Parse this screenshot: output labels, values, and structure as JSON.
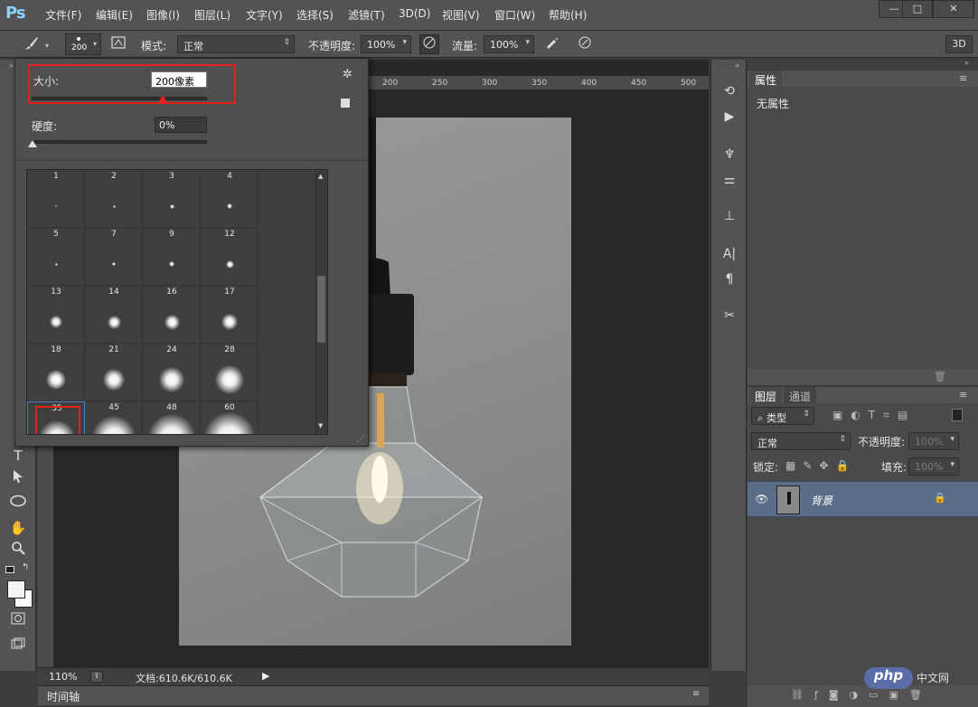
{
  "app": {
    "logo": "Ps"
  },
  "menu": [
    "文件(F)",
    "编辑(E)",
    "图像(I)",
    "图层(L)",
    "文字(Y)",
    "选择(S)",
    "滤镜(T)",
    "3D(D)",
    "视图(V)",
    "窗口(W)",
    "帮助(H)"
  ],
  "window_buttons": [
    "—",
    "□",
    "✕"
  ],
  "options": {
    "brush_size": "200",
    "mode_label": "模式:",
    "mode_value": "正常",
    "opacity_label": "不透明度:",
    "opacity_value": "100%",
    "flow_label": "流量:",
    "flow_value": "100%",
    "threed_label": "3D"
  },
  "brush_popup": {
    "size_label": "大小:",
    "size_value": "200像素",
    "hardness_label": "硬度:",
    "hardness_value": "0%",
    "presets": [
      {
        "label": "1",
        "d": 2
      },
      {
        "label": "2",
        "d": 3
      },
      {
        "label": "3",
        "d": 5
      },
      {
        "label": "4",
        "d": 6
      },
      {
        "label": "5",
        "d": 3
      },
      {
        "label": "7",
        "d": 4
      },
      {
        "label": "9",
        "d": 6
      },
      {
        "label": "12",
        "d": 9
      },
      {
        "label": "13",
        "d": 14
      },
      {
        "label": "14",
        "d": 15
      },
      {
        "label": "16",
        "d": 17
      },
      {
        "label": "17",
        "d": 18
      },
      {
        "label": "18",
        "d": 22
      },
      {
        "label": "21",
        "d": 24
      },
      {
        "label": "24",
        "d": 28
      },
      {
        "label": "28",
        "d": 32
      },
      {
        "label": "35",
        "d": 40
      },
      {
        "label": "45",
        "d": 48
      },
      {
        "label": "48",
        "d": 52
      },
      {
        "label": "60",
        "d": 56
      },
      {
        "label": "",
        "d": 52
      },
      {
        "label": "",
        "d": 52
      },
      {
        "label": "",
        "d": 52
      },
      {
        "label": "",
        "d": 52
      }
    ]
  },
  "rulers": {
    "top": [
      "200",
      "250",
      "300",
      "350",
      "400",
      "450",
      "500"
    ]
  },
  "status": {
    "zoom": "110%",
    "doc": "文档:610.6K/610.6K"
  },
  "timeline_label": "时间轴",
  "properties": {
    "tab": "属性",
    "content": "无属性"
  },
  "layers": {
    "tabs": [
      "图层",
      "通道"
    ],
    "filter_label": "类型",
    "blend_value": "正常",
    "opacity_label": "不透明度:",
    "opacity_value": "100%",
    "lock_label": "锁定:",
    "fill_label": "填充:",
    "fill_value": "100%",
    "layer_name": "背景"
  },
  "watermark": {
    "brand": "php",
    "suffix": "中文网"
  }
}
